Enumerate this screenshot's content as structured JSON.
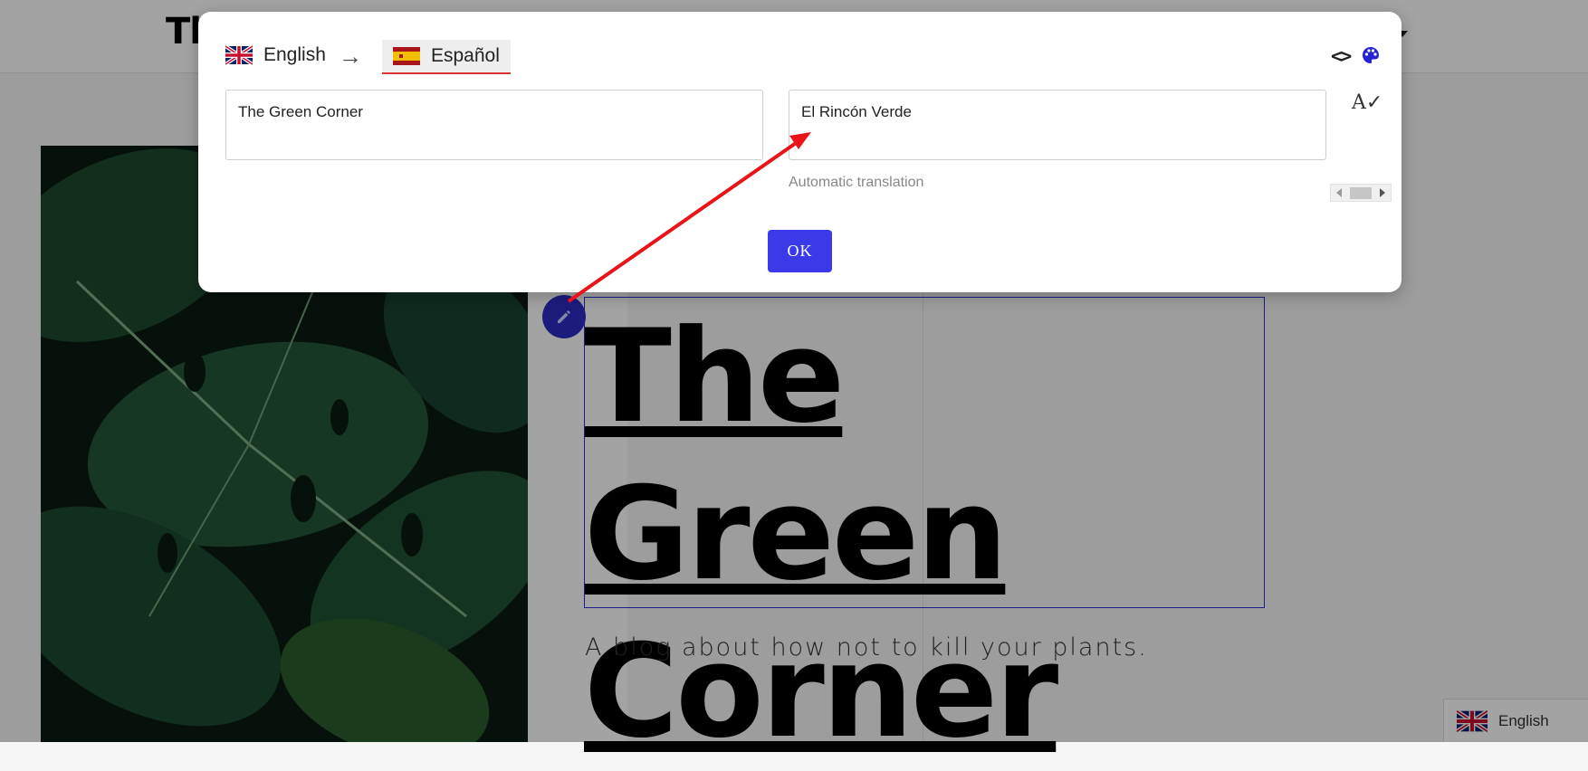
{
  "site": {
    "logo_text": "Th",
    "hero_title_line1": "The Green",
    "hero_title_line2": "Corner",
    "hero_subtitle": "A blog about how not to kill your plants."
  },
  "language_switcher": {
    "label": "English",
    "flag_icon": "uk-flag-icon"
  },
  "dialog": {
    "source_language": "English",
    "source_flag_icon": "uk-flag-icon",
    "arrow": "→",
    "target_language": "Español",
    "target_flag_icon": "spain-flag-icon",
    "source_text": "The Green Corner",
    "target_text": "El Rincón Verde",
    "automatic_translation_note": "Automatic translation",
    "ok_label": "OK",
    "code_icon": "code-icon",
    "palette_icon": "palette-icon",
    "spellcheck_icon": "spellcheck-icon"
  },
  "colors": {
    "accent": "#3a3ae8",
    "selection_border": "#2b2bd6",
    "annotation_arrow": "#e8141a",
    "edit_badge": "#2d2dc4"
  }
}
